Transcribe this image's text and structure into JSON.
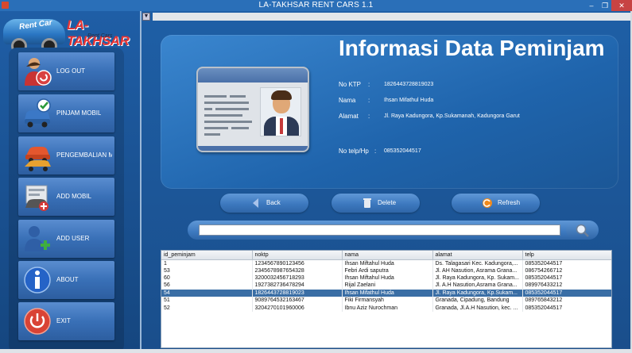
{
  "window": {
    "title": "LA-TAKHSAR RENT CARS 1.1"
  },
  "logo": {
    "brand": "LA-TAKHSAR",
    "subtitle": "Rent Cars",
    "badge": "Rent Car"
  },
  "menu": [
    {
      "id": "logout",
      "label": "LOG OUT",
      "icon": "user-logout-icon"
    },
    {
      "id": "pinjam",
      "label": "PINJAM MOBIL",
      "icon": "car-check-icon"
    },
    {
      "id": "pengembalian",
      "label": "PENGEMBALIAN M...",
      "icon": "car-return-icon"
    },
    {
      "id": "addmobil",
      "label": "ADD MOBIL",
      "icon": "add-car-icon"
    },
    {
      "id": "adduser",
      "label": "ADD USER",
      "icon": "add-user-icon"
    },
    {
      "id": "about",
      "label": "ABOUT",
      "icon": "info-icon"
    },
    {
      "id": "exit",
      "label": "EXIT",
      "icon": "power-icon"
    }
  ],
  "info": {
    "title": "Informasi Data Peminjam",
    "fields": [
      {
        "label": "No KTP",
        "value": "1826443728819023"
      },
      {
        "label": "Nama",
        "value": "Ihsan Mifathul Huda"
      },
      {
        "label": "Alamat",
        "value": "Jl. Raya Kadungora, Kp.Sukamanah, Kadungora Garut"
      },
      {
        "label": "No telp/Hp",
        "value": "085352044517"
      }
    ]
  },
  "actions": {
    "back": "Back",
    "delete": "Delete",
    "refresh": "Refresh"
  },
  "search": {
    "value": "",
    "placeholder": ""
  },
  "table": {
    "columns": [
      "id_peminjam",
      "noktp",
      "nama",
      "alamat",
      "telp"
    ],
    "selected_index": 4,
    "rows": [
      [
        "1",
        "1234567890123456",
        "Ihsan Miftahul Huda",
        "Ds. Talagasari Kec. Kadungora,...",
        "085352044517"
      ],
      [
        "53",
        "2345678987654328",
        "Febri Ardi saputra",
        "Jl. AH Nasution, Asrama Grana...",
        "086754266712"
      ],
      [
        "60",
        "3200032456718293",
        "Ihsan Miftahul Huda",
        "Jl. Raya Kadungora, Kp. Sukam...",
        "085352044517"
      ],
      [
        "56",
        "1927382736478294",
        "Rijal Zaelani",
        "Jl. A.H Nasution,Asrama Grana...",
        "089976433212"
      ],
      [
        "54",
        "1826443728819023",
        "Ihsan Mifathul Huda",
        "Jl. Raya Kadungora, Kp.Sukam...",
        "085352044517"
      ],
      [
        "51",
        "9089764532163467",
        "Fiki Firmansyah",
        "Granada, Cipadung, Bandung",
        "089765843212"
      ],
      [
        "52",
        "3204270101960006",
        "Ibnu Aziz Nurochman",
        "Granada, Jl.A.H Nasution, kec. ...",
        "085352044517"
      ]
    ]
  }
}
